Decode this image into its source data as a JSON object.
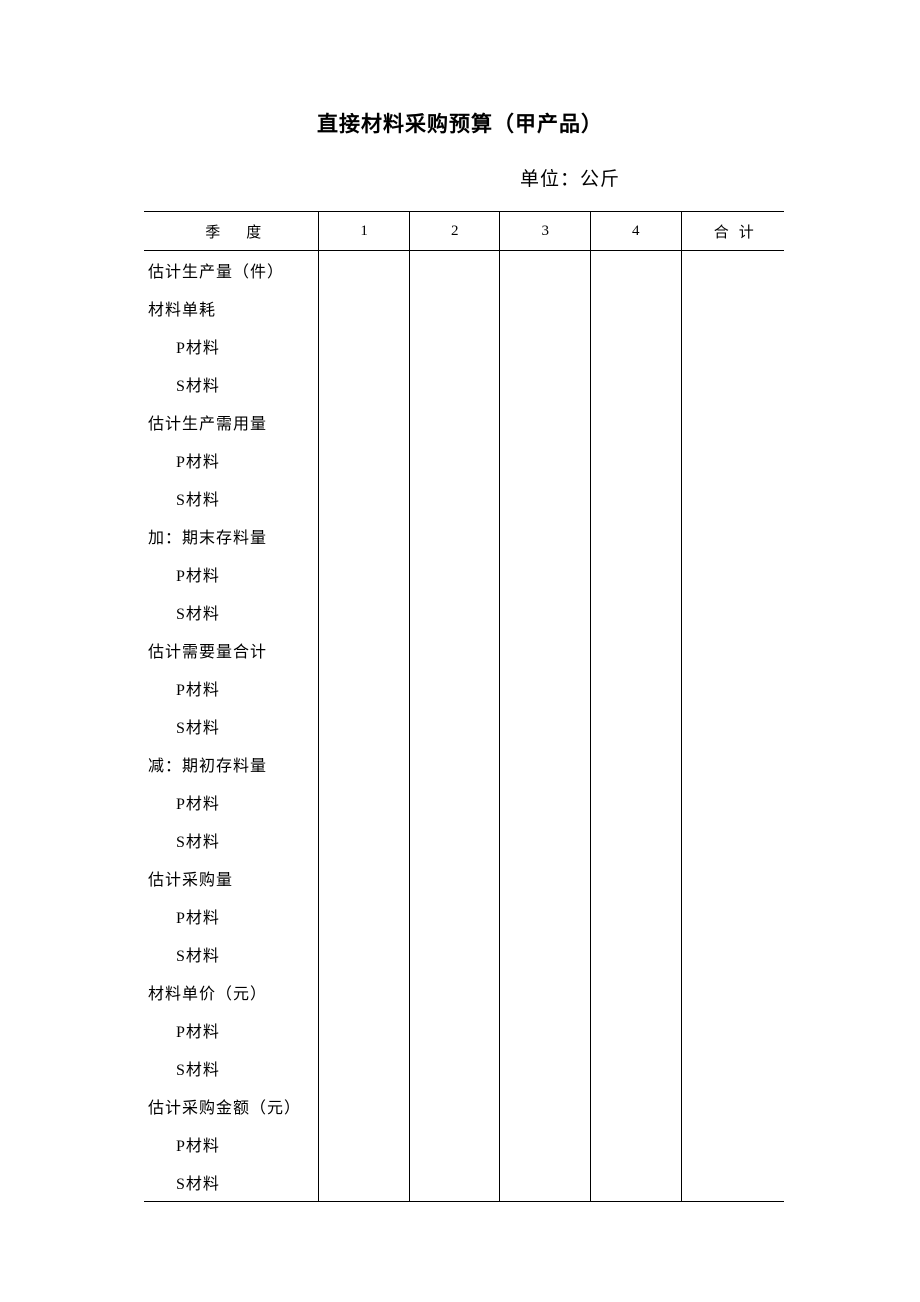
{
  "title": "直接材料采购预算（甲产品）",
  "unit_label": "单位：公斤",
  "header": {
    "quarter_label": "季度",
    "q1": "1",
    "q2": "2",
    "q3": "3",
    "q4": "4",
    "total": "合计"
  },
  "rows": [
    {
      "label": "估计生产量（件）",
      "indent": false,
      "q1": "",
      "q2": "",
      "q3": "",
      "q4": "",
      "total": ""
    },
    {
      "label": "材料单耗",
      "indent": false,
      "q1": "",
      "q2": "",
      "q3": "",
      "q4": "",
      "total": ""
    },
    {
      "label": "P材料",
      "indent": true,
      "q1": "",
      "q2": "",
      "q3": "",
      "q4": "",
      "total": ""
    },
    {
      "label": "S材料",
      "indent": true,
      "q1": "",
      "q2": "",
      "q3": "",
      "q4": "",
      "total": ""
    },
    {
      "label": "估计生产需用量",
      "indent": false,
      "q1": "",
      "q2": "",
      "q3": "",
      "q4": "",
      "total": ""
    },
    {
      "label": "P材料",
      "indent": true,
      "q1": "",
      "q2": "",
      "q3": "",
      "q4": "",
      "total": ""
    },
    {
      "label": "S材料",
      "indent": true,
      "q1": "",
      "q2": "",
      "q3": "",
      "q4": "",
      "total": ""
    },
    {
      "label": "加：期末存料量",
      "indent": false,
      "q1": "",
      "q2": "",
      "q3": "",
      "q4": "",
      "total": ""
    },
    {
      "label": "P材料",
      "indent": true,
      "q1": "",
      "q2": "",
      "q3": "",
      "q4": "",
      "total": ""
    },
    {
      "label": "S材料",
      "indent": true,
      "q1": "",
      "q2": "",
      "q3": "",
      "q4": "",
      "total": ""
    },
    {
      "label": "估计需要量合计",
      "indent": false,
      "q1": "",
      "q2": "",
      "q3": "",
      "q4": "",
      "total": ""
    },
    {
      "label": "P材料",
      "indent": true,
      "q1": "",
      "q2": "",
      "q3": "",
      "q4": "",
      "total": ""
    },
    {
      "label": "S材料",
      "indent": true,
      "q1": "",
      "q2": "",
      "q3": "",
      "q4": "",
      "total": ""
    },
    {
      "label": "减：期初存料量",
      "indent": false,
      "q1": "",
      "q2": "",
      "q3": "",
      "q4": "",
      "total": ""
    },
    {
      "label": "P材料",
      "indent": true,
      "q1": "",
      "q2": "",
      "q3": "",
      "q4": "",
      "total": ""
    },
    {
      "label": "S材料",
      "indent": true,
      "q1": "",
      "q2": "",
      "q3": "",
      "q4": "",
      "total": ""
    },
    {
      "label": "估计采购量",
      "indent": false,
      "q1": "",
      "q2": "",
      "q3": "",
      "q4": "",
      "total": ""
    },
    {
      "label": "P材料",
      "indent": true,
      "q1": "",
      "q2": "",
      "q3": "",
      "q4": "",
      "total": ""
    },
    {
      "label": "S材料",
      "indent": true,
      "q1": "",
      "q2": "",
      "q3": "",
      "q4": "",
      "total": ""
    },
    {
      "label": "材料单价（元）",
      "indent": false,
      "q1": "",
      "q2": "",
      "q3": "",
      "q4": "",
      "total": ""
    },
    {
      "label": "P材料",
      "indent": true,
      "q1": "",
      "q2": "",
      "q3": "",
      "q4": "",
      "total": ""
    },
    {
      "label": "S材料",
      "indent": true,
      "q1": "",
      "q2": "",
      "q3": "",
      "q4": "",
      "total": ""
    },
    {
      "label": "估计采购金额（元）",
      "indent": false,
      "q1": "",
      "q2": "",
      "q3": "",
      "q4": "",
      "total": ""
    },
    {
      "label": "P材料",
      "indent": true,
      "q1": "",
      "q2": "",
      "q3": "",
      "q4": "",
      "total": ""
    },
    {
      "label": "S材料",
      "indent": true,
      "q1": "",
      "q2": "",
      "q3": "",
      "q4": "",
      "total": ""
    }
  ]
}
